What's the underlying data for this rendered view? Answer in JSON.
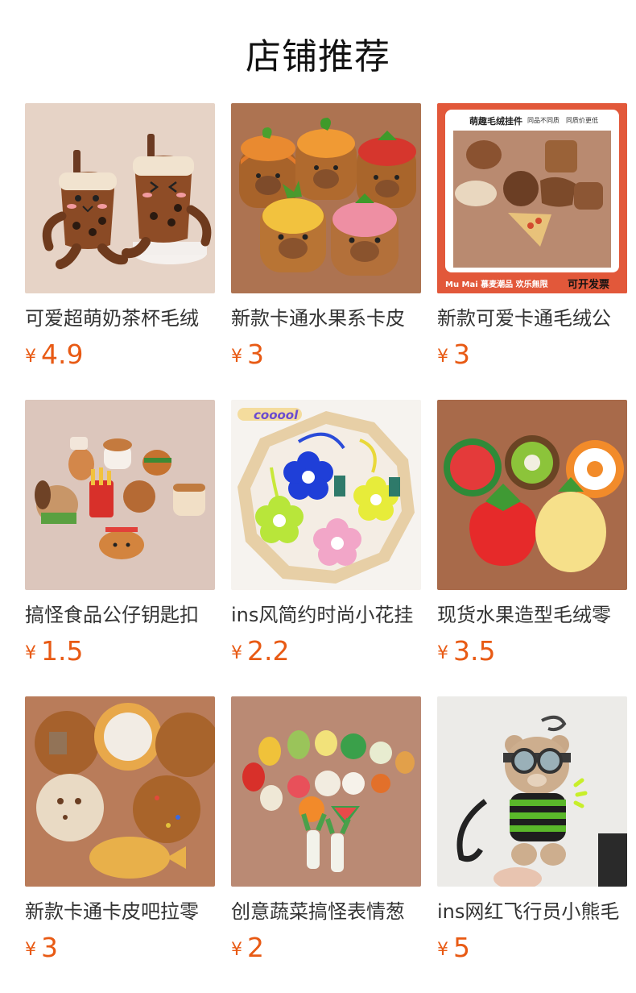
{
  "section": {
    "title": "店铺推荐"
  },
  "currency_symbol": "¥",
  "colors": {
    "price": "#e85a14",
    "title_text": "#333333"
  },
  "products": [
    {
      "title": "可爱超萌奶茶杯毛绒",
      "price": "4.9",
      "image_icon": "milk-tea-plush-image"
    },
    {
      "title": "新款卡通水果系卡皮",
      "price": "3",
      "image_icon": "capybara-fruit-plush-image"
    },
    {
      "title": "新款可爱卡通毛绒公",
      "price": "3",
      "image_icon": "bread-plush-poster-image",
      "poster": {
        "header": "萌趣毛绒挂件",
        "tag1": "同品不同质",
        "tag2": "同质价更低",
        "footer_left": "Mu Mai 慕麦潮品 欢乐無限",
        "footer_right": "可开发票"
      }
    },
    {
      "title": "搞怪食品公仔钥匙扣",
      "price": "1.5",
      "image_icon": "food-plush-keychain-image"
    },
    {
      "title": "ins风简约时尚小花挂",
      "price": "2.2",
      "image_icon": "flower-plush-charm-image",
      "stamp": "cooool"
    },
    {
      "title": "现货水果造型毛绒零",
      "price": "3.5",
      "image_icon": "fruit-plush-pouch-image"
    },
    {
      "title": "新款卡通卡皮吧拉零",
      "price": "3",
      "image_icon": "capybara-cookie-pouch-image"
    },
    {
      "title": "创意蔬菜搞怪表情葱",
      "price": "2",
      "image_icon": "vegetable-plush-image"
    },
    {
      "title": "ins网红飞行员小熊毛",
      "price": "5",
      "image_icon": "pilot-bear-plush-image"
    }
  ]
}
